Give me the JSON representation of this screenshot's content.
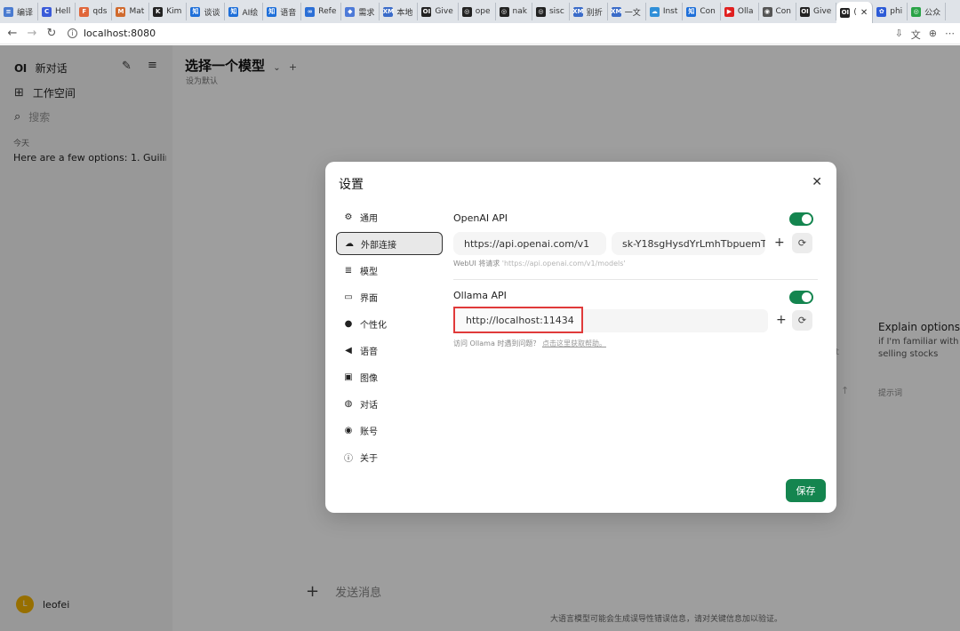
{
  "browser": {
    "tabs": [
      {
        "label": "编译",
        "color": "#4a7bd0",
        "glyph": "≡"
      },
      {
        "label": "Hell",
        "color": "#3a5bd9",
        "glyph": "C"
      },
      {
        "label": "qds",
        "color": "#e0663a",
        "glyph": "F"
      },
      {
        "label": "Mat",
        "color": "#d06a2e",
        "glyph": "M"
      },
      {
        "label": "Kim",
        "color": "#222222",
        "glyph": "K"
      },
      {
        "label": "谈谈",
        "color": "#1e6fd9",
        "glyph": "知"
      },
      {
        "label": "AI绘",
        "color": "#1e6fd9",
        "glyph": "知"
      },
      {
        "label": "语音",
        "color": "#1e6fd9",
        "glyph": "知"
      },
      {
        "label": "Refe",
        "color": "#2b6fd6",
        "glyph": "∞"
      },
      {
        "label": "需求",
        "color": "#4d7ad8",
        "glyph": "◆"
      },
      {
        "label": "本地",
        "color": "#3b6cc9",
        "glyph": "XM"
      },
      {
        "label": "Give",
        "color": "#222222",
        "glyph": "OI"
      },
      {
        "label": "ope",
        "color": "#222222",
        "glyph": "◎"
      },
      {
        "label": "nak",
        "color": "#222222",
        "glyph": "◎"
      },
      {
        "label": "sisc",
        "color": "#222222",
        "glyph": "◎"
      },
      {
        "label": "别折",
        "color": "#3b6cc9",
        "glyph": "XM"
      },
      {
        "label": "一文",
        "color": "#3b6cc9",
        "glyph": "XM"
      },
      {
        "label": "Inst",
        "color": "#2f8fd8",
        "glyph": "☁"
      },
      {
        "label": "Con",
        "color": "#1e6fd9",
        "glyph": "知"
      },
      {
        "label": "Olla",
        "color": "#e02020",
        "glyph": "▶"
      },
      {
        "label": "Con",
        "color": "#555555",
        "glyph": "◉"
      },
      {
        "label": "Give",
        "color": "#222222",
        "glyph": "OI"
      },
      {
        "label": "(",
        "color": "#222222",
        "glyph": "OI"
      },
      {
        "label": "phi",
        "color": "#2d5bd7",
        "glyph": "✿"
      },
      {
        "label": "公众",
        "color": "#29a346",
        "glyph": "◎"
      }
    ],
    "url": "localhost:8080"
  },
  "sidebar": {
    "logo": "OI",
    "new_chat": "新对话",
    "workspace": "工作空间",
    "search_placeholder": "搜索",
    "section_today": "今天",
    "history_item": "Here are a few options: 1. Guilin Sc",
    "user_initial": "L",
    "user_name": "leofei"
  },
  "main": {
    "model_selector": "选择一个模型",
    "set_default": "设为默认",
    "suggestion": {
      "title": "Explain options",
      "subtitle": "if I'm familiar with selling stocks",
      "tag": "提示词"
    },
    "composer_placeholder": "发送消息",
    "disclaimer": "大语言模型可能会生成误导性错误信息，请对关键信息加以验证。"
  },
  "settings": {
    "title": "设置",
    "menu": [
      {
        "label": "通用",
        "icon": "gear-icon"
      },
      {
        "label": "外部连接",
        "icon": "cloud-icon"
      },
      {
        "label": "模型",
        "icon": "database-icon"
      },
      {
        "label": "界面",
        "icon": "monitor-icon"
      },
      {
        "label": "个性化",
        "icon": "user-icon"
      },
      {
        "label": "语音",
        "icon": "speaker-icon"
      },
      {
        "label": "图像",
        "icon": "image-icon"
      },
      {
        "label": "对话",
        "icon": "chat-icon"
      },
      {
        "label": "账号",
        "icon": "account-icon"
      },
      {
        "label": "关于",
        "icon": "info-icon"
      }
    ],
    "active_menu": "外部连接",
    "openai": {
      "label": "OpenAI API",
      "enabled": true,
      "base_url": "https://api.openai.com/v1",
      "api_key": "sk-Y18sgHysdYrLmhTbpuemT3",
      "hint_prefix": "WebUI 将请求",
      "hint_url": "'https://api.openai.com/v1/models'"
    },
    "ollama": {
      "label": "Ollama API",
      "enabled": true,
      "base_url": "http://localhost:11434",
      "hint_prefix": "访问 Ollama 时遇到问题？",
      "hint_link": "点击这里获取帮助。"
    },
    "save_label": "保存",
    "accent_color": "#14854f"
  }
}
